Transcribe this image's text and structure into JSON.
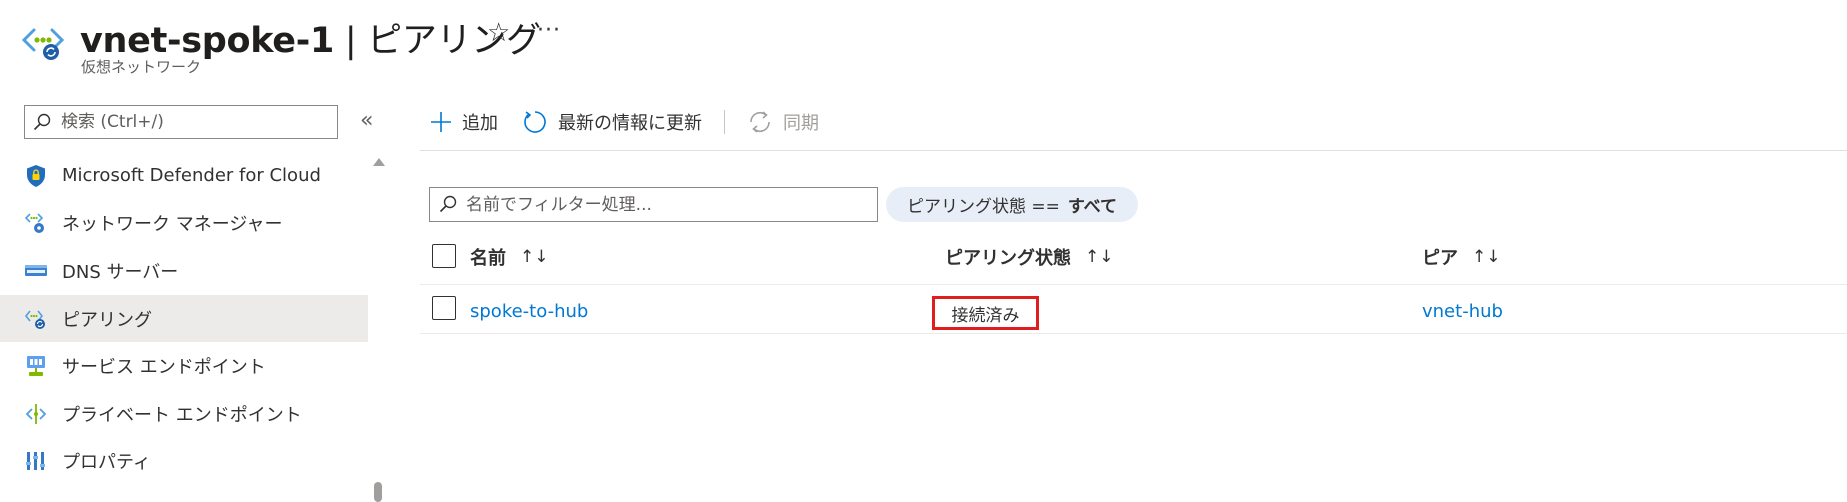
{
  "header": {
    "resource_name": "vnet-spoke-1",
    "separator": " | ",
    "page_name": "ピアリング",
    "subtitle": "仮想ネットワーク",
    "star_glyph": "☆",
    "more_glyph": "···"
  },
  "sidebar": {
    "search_placeholder": "検索 (Ctrl+/)",
    "collapse_glyph": "«",
    "items": [
      {
        "label": "Microsoft Defender for Cloud",
        "icon": "defender-shield-icon",
        "active": false
      },
      {
        "label": "ネットワーク マネージャー",
        "icon": "network-manager-icon",
        "active": false
      },
      {
        "label": "DNS サーバー",
        "icon": "dns-server-icon",
        "active": false
      },
      {
        "label": "ピアリング",
        "icon": "peering-icon",
        "active": true
      },
      {
        "label": "サービス エンドポイント",
        "icon": "service-endpoint-icon",
        "active": false
      },
      {
        "label": "プライベート エンドポイント",
        "icon": "private-endpoint-icon",
        "active": false
      },
      {
        "label": "プロパティ",
        "icon": "properties-icon",
        "active": false
      }
    ]
  },
  "toolbar": {
    "add_label": "追加",
    "refresh_label": "最新の情報に更新",
    "sync_label": "同期"
  },
  "filter": {
    "placeholder": "名前でフィルター処理...",
    "pill_prefix": "ピアリング状態 ==",
    "pill_value": "すべて"
  },
  "table": {
    "columns": [
      "名前",
      "ピアリング状態",
      "ピア"
    ],
    "sort_glyph": "↑↓",
    "rows": [
      {
        "name": "spoke-to-hub",
        "status": "接続済み",
        "peer": "vnet-hub"
      }
    ]
  },
  "colors": {
    "accent": "#0078d4",
    "highlight_border": "#e01e1e",
    "active_nav_bg": "#edebe9"
  }
}
